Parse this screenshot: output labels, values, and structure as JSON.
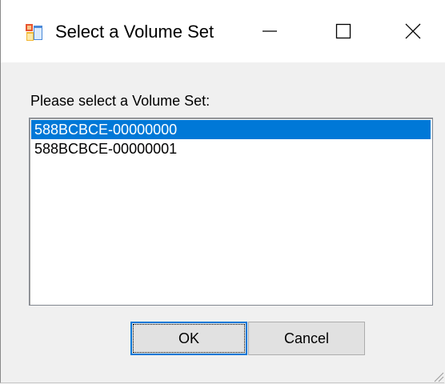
{
  "window": {
    "title": "Select a Volume Set",
    "icons": {
      "app": "application-window-icon",
      "minimize": "minimize-icon",
      "maximize": "maximize-icon",
      "close": "close-icon",
      "grip": "resize-grip-icon"
    }
  },
  "dialog": {
    "prompt": "Please select a Volume Set:",
    "volume_sets": [
      {
        "label": "588BCBCE-00000000",
        "selected": true
      },
      {
        "label": "588BCBCE-00000001",
        "selected": false
      }
    ],
    "ok_label": "OK",
    "cancel_label": "Cancel"
  },
  "colors": {
    "selection": "#0078d7",
    "button_face": "#e1e1e1",
    "window_background": "#f0f0f0"
  }
}
